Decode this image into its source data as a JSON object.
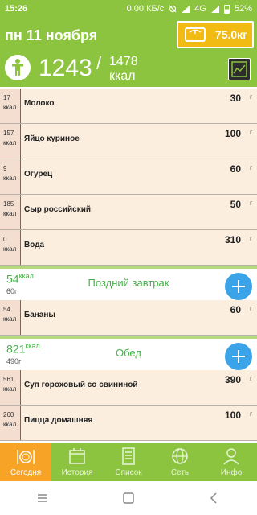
{
  "status": {
    "time": "15:26",
    "speed": "0,00 КБ/с",
    "network": "4G",
    "battery": "52%"
  },
  "header": {
    "date": "пн 11 ноября",
    "weight": "75.0кг"
  },
  "summary": {
    "eaten": "1243",
    "separator": "/",
    "goal": "1478",
    "unit": "ккал"
  },
  "colors": {
    "brand_green": "#8cc43f",
    "accent_orange": "#f7a325",
    "weight_yellow": "#f2bb13",
    "add_blue": "#3ba4e8",
    "meal_green": "#47b04a",
    "row_bg": "#fbeede"
  },
  "entries": [
    {
      "kcal": "17",
      "kcal_unit": "ккал",
      "name": "Молоко",
      "amount": "30",
      "unit": "г"
    },
    {
      "kcal": "157",
      "kcal_unit": "ккал",
      "name": "Яйцо куриное",
      "amount": "100",
      "unit": "г"
    },
    {
      "kcal": "9",
      "kcal_unit": "ккал",
      "name": "Огурец",
      "amount": "60",
      "unit": "г"
    },
    {
      "kcal": "185",
      "kcal_unit": "ккал",
      "name": "Сыр российский",
      "amount": "50",
      "unit": "г"
    },
    {
      "kcal": "0",
      "kcal_unit": "ккал",
      "name": "Вода",
      "amount": "310",
      "unit": "г"
    }
  ],
  "meals": [
    {
      "kcal": "54",
      "kcal_unit": "ккал",
      "weight": "60",
      "weight_unit": "г",
      "name": "Поздний завтрак",
      "entries": [
        {
          "kcal": "54",
          "kcal_unit": "ккал",
          "name": "Бананы",
          "amount": "60",
          "unit": "г"
        }
      ]
    },
    {
      "kcal": "821",
      "kcal_unit": "ккал",
      "weight": "490",
      "weight_unit": "г",
      "name": "Обед",
      "entries": [
        {
          "kcal": "561",
          "kcal_unit": "ккал",
          "name": "Суп гороховый со свининой",
          "amount": "390",
          "unit": "г"
        },
        {
          "kcal": "260",
          "kcal_unit": "ккал",
          "name": "Пицца домашняя",
          "amount": "100",
          "unit": "г"
        }
      ]
    }
  ],
  "tabs": [
    {
      "label": "Сегодня",
      "icon": "plate-icon",
      "active": true
    },
    {
      "label": "История",
      "icon": "calendar-icon",
      "active": false
    },
    {
      "label": "Список",
      "icon": "list-icon",
      "active": false
    },
    {
      "label": "Сеть",
      "icon": "globe-icon",
      "active": false
    },
    {
      "label": "Инфо",
      "icon": "person-icon",
      "active": false
    }
  ]
}
